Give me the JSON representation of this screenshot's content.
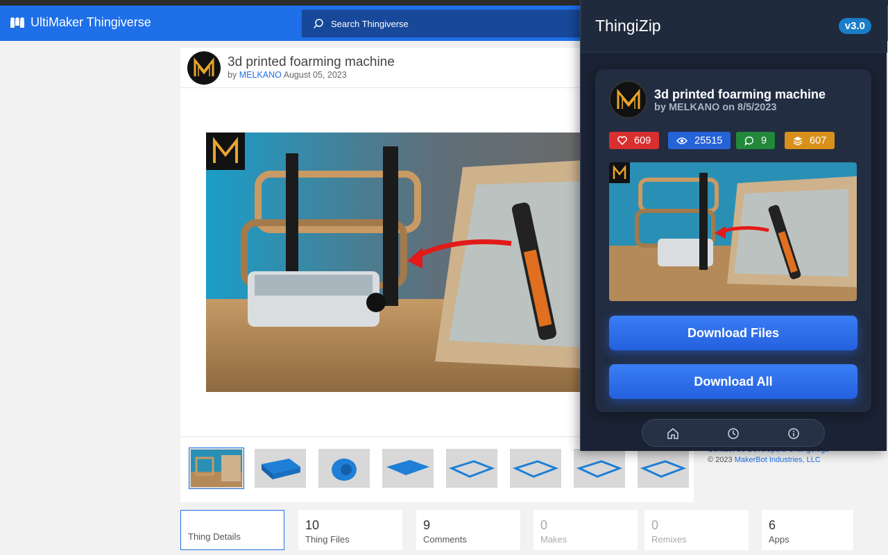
{
  "header": {
    "brand": "UltiMaker Thingiverse",
    "search_placeholder": "Search Thingiverse"
  },
  "thing": {
    "title": "3d printed foarming machine",
    "by_prefix": "by",
    "author": "MELKANO",
    "date": "August 05, 2023",
    "thumbnail_count": 8
  },
  "tabs": [
    {
      "number": "",
      "label": "Thing Details"
    },
    {
      "number": "10",
      "label": "Thing Files"
    },
    {
      "number": "9",
      "label": "Comments"
    },
    {
      "number": "0",
      "label": "Makes"
    },
    {
      "number": "0",
      "label": "Remixes"
    },
    {
      "number": "6",
      "label": "Apps"
    }
  ],
  "footer": {
    "links": "Contact Us  Developers  Changelogs",
    "copyright_prefix": "© 2023",
    "company": "MakerBot Industries, LLC"
  },
  "popup": {
    "title": "ThingiZip",
    "version": "v3.0",
    "thing_title": "3d printed foarming machine",
    "thing_by": "by MELKANO on 8/5/2023",
    "likes": "609",
    "views": "25515",
    "comments": "9",
    "makes": "607",
    "download_files": "Download Files",
    "download_all": "Download All"
  },
  "colors": {
    "header_blue": "#1e6fe8",
    "popup_bg": "#1a2233",
    "button_blue": "#2563eb",
    "likes_red": "#d82f2f",
    "views_blue": "#2563d6",
    "comments_green": "#22883a",
    "makes_orange": "#d8901a"
  }
}
